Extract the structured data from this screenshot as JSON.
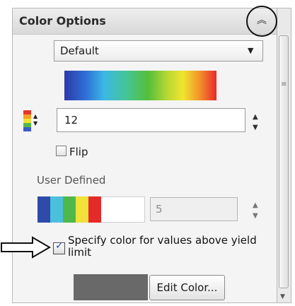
{
  "header": {
    "title": "Color Options",
    "collapse_icon": "double-chevron-up"
  },
  "preset": {
    "selected": "Default",
    "arrow": "▼"
  },
  "count": {
    "value": "12",
    "spin_up": "▲",
    "spin_down": "▼"
  },
  "flip": {
    "label": "Flip",
    "checked": false
  },
  "user_defined": {
    "label": "User Defined",
    "value": "5",
    "swatches": [
      "#2f4aa8",
      "#4ac0dc",
      "#4fb84a",
      "#f0e23a",
      "#e52a2a"
    ],
    "spin_up": "▲",
    "spin_down": "▼"
  },
  "yield": {
    "label": "Specify color for values above yield limit",
    "checked": true,
    "swatch_color": "#696969",
    "edit_button_label": "Edit Color..."
  },
  "glyphs": {
    "check": "✓",
    "chevron_up_double": "︽",
    "grip": "≡",
    "spin": "⇕"
  }
}
